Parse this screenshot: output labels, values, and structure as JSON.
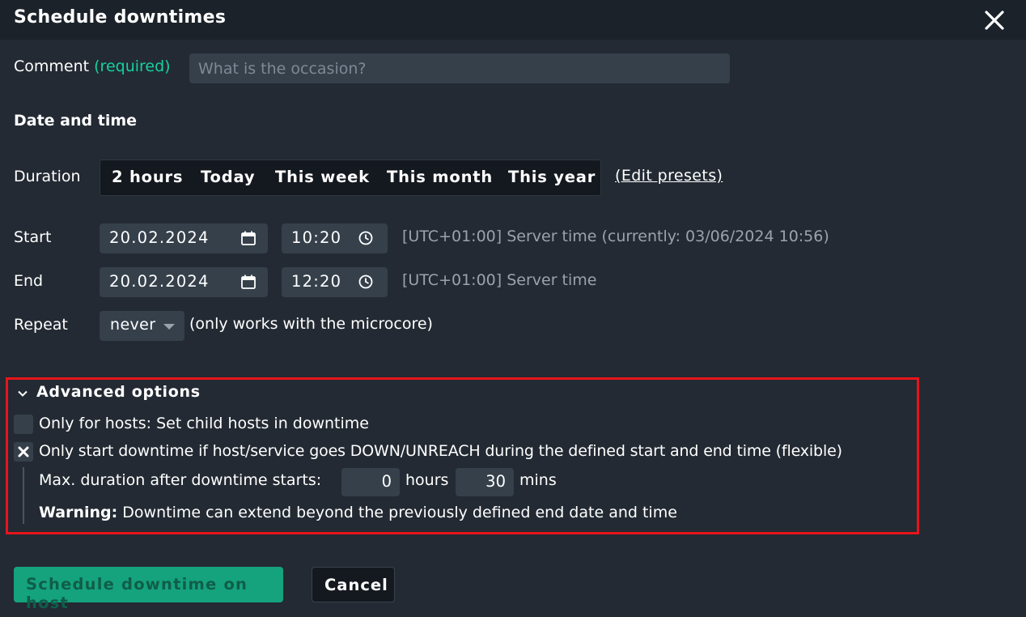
{
  "dialog": {
    "title": "Schedule downtimes",
    "close_icon": "close-icon"
  },
  "comment": {
    "label": "Comment",
    "required": "(required)",
    "placeholder": "What is the occasion?",
    "value": ""
  },
  "date_time": {
    "heading": "Date and time",
    "duration_label": "Duration",
    "presets": [
      "2 hours",
      "Today",
      "This week",
      "This month",
      "This year"
    ],
    "edit_presets": "(Edit presets)",
    "start": {
      "label": "Start",
      "date": "20.02.2024",
      "time": "10:20",
      "note": "[UTC+01:00] Server time (currently: 03/06/2024 10:56)"
    },
    "end": {
      "label": "End",
      "date": "20.02.2024",
      "time": "12:20",
      "note": "[UTC+01:00] Server time"
    },
    "repeat": {
      "label": "Repeat",
      "selected": "never",
      "note": "(only works with the microcore)"
    }
  },
  "advanced": {
    "toggle_label": "Advanced options",
    "expanded": true,
    "child_hosts": {
      "label": "Only for hosts: Set child hosts in downtime",
      "checked": false
    },
    "flexible": {
      "label": "Only start downtime if host/service goes DOWN/UNREACH during the defined start and end time (flexible)",
      "checked": true
    },
    "max_duration": {
      "label": "Max. duration after downtime starts:",
      "hours_value": "0",
      "hours_unit": "hours",
      "mins_value": "30",
      "mins_unit": "mins"
    },
    "warning": {
      "prefix": "Warning:",
      "text": "Downtime can extend beyond the previously defined end date and time"
    }
  },
  "actions": {
    "submit": "Schedule downtime on host",
    "cancel": "Cancel"
  },
  "colors": {
    "background": "#232a33",
    "titlebar": "#1b2229",
    "input": "#35404b",
    "accent_green": "#15d1a0",
    "button_green": "#15a37d",
    "highlight": "#e8141b"
  }
}
